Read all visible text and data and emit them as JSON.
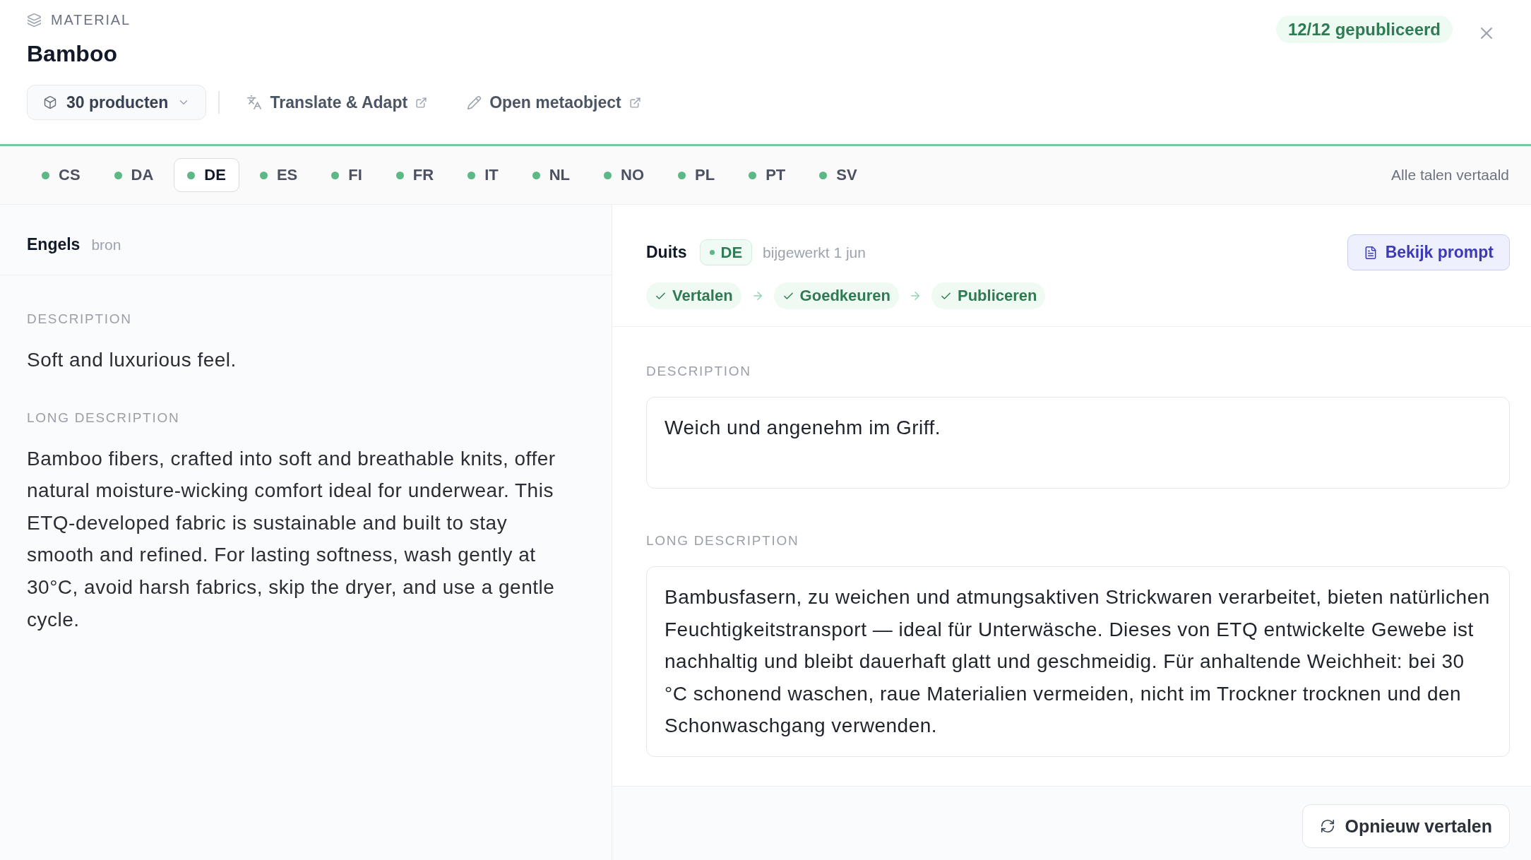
{
  "header": {
    "eyebrow": "MATERIAL",
    "title": "Bamboo",
    "status_badge": "12/12 gepubliceerd"
  },
  "toolbar": {
    "products_button": "30 producten",
    "translate_link": "Translate & Adapt",
    "metaobject_link": "Open metaobject"
  },
  "language_tabs": [
    {
      "label": "CS",
      "selected": false,
      "translated": true
    },
    {
      "label": "DA",
      "selected": false,
      "translated": true
    },
    {
      "label": "DE",
      "selected": true,
      "translated": true
    },
    {
      "label": "ES",
      "selected": false,
      "translated": true
    },
    {
      "label": "FI",
      "selected": false,
      "translated": true
    },
    {
      "label": "FR",
      "selected": false,
      "translated": true
    },
    {
      "label": "IT",
      "selected": false,
      "translated": true
    },
    {
      "label": "NL",
      "selected": false,
      "translated": true
    },
    {
      "label": "NO",
      "selected": false,
      "translated": true
    },
    {
      "label": "PL",
      "selected": false,
      "translated": true
    },
    {
      "label": "PT",
      "selected": false,
      "translated": true
    },
    {
      "label": "SV",
      "selected": false,
      "translated": true
    }
  ],
  "tabs_status": "Alle talen vertaald",
  "source": {
    "language": "Engels",
    "tag": "bron",
    "fields": [
      {
        "label": "DESCRIPTION",
        "value": "Soft and luxurious feel."
      },
      {
        "label": "LONG DESCRIPTION",
        "value": "Bamboo fibers, crafted into soft and breathable knits, offer natural moisture-wicking comfort ideal for underwear. This ETQ-developed fabric is sustainable and built to stay smooth and refined. For lasting softness, wash gently at 30°C, avoid harsh fabrics, skip the dryer, and use a gentle cycle."
      }
    ]
  },
  "target": {
    "language": "Duits",
    "code": "DE",
    "updated": "bijgewerkt 1 jun",
    "prompt_button": "Bekijk prompt",
    "steps": [
      {
        "label": "Vertalen",
        "done": true
      },
      {
        "label": "Goedkeuren",
        "done": true
      },
      {
        "label": "Publiceren",
        "done": true
      }
    ],
    "fields": [
      {
        "label": "DESCRIPTION",
        "value": "Weich und angenehm im Griff."
      },
      {
        "label": "LONG DESCRIPTION",
        "value": "Bambusfasern, zu weichen und atmungsaktiven Strickwaren verarbeitet, bieten natürlichen Feuchtigkeitstransport — ideal für Unterwäsche. Dieses von ETQ entwickelte Gewebe ist nachhaltig und bleibt dauerhaft glatt und geschmeidig. Für anhaltende Weichheit: bei 30 °C schonend waschen, raue Materialien vermeiden, nicht im Trockner trocknen und den Schonwaschgang verwenden."
      }
    ]
  },
  "footer": {
    "retranslate_button": "Opnieuw vertalen"
  }
}
